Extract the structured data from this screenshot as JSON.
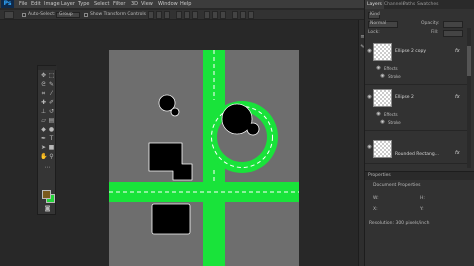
{
  "app": {
    "logo": "Ps"
  },
  "menu": [
    "File",
    "Edit",
    "Image",
    "Layer",
    "Type",
    "Select",
    "Filter",
    "3D",
    "View",
    "Window",
    "Help"
  ],
  "options_bar": {
    "auto_select_label": "Auto-Select:",
    "auto_select_value": "Group",
    "transform_controls_label": "Show Transform Controls"
  },
  "colors": {
    "accent_green": "#19e33a",
    "canvas_gray": "#6e6e6e",
    "shape_black": "#000000",
    "road_dash": "#ffffff",
    "foreground_swatch": "#7a5a1e",
    "background_swatch": "#24d43a"
  },
  "tools": [
    "move-tool",
    "marquee-tool",
    "lasso-tool",
    "quick-select-tool",
    "crop-tool",
    "eyedropper-tool",
    "healing-tool",
    "brush-tool",
    "stamp-tool",
    "history-brush-tool",
    "eraser-tool",
    "gradient-tool",
    "blur-tool",
    "dodge-tool",
    "pen-tool",
    "type-tool",
    "path-select-tool",
    "shape-tool",
    "hand-tool",
    "zoom-tool"
  ],
  "layers_panel": {
    "tabs": [
      "Layers",
      "Channels",
      "Paths",
      "Swatches"
    ],
    "filter_label": "Kind",
    "blend_mode": "Normal",
    "opacity_label": "Opacity:",
    "lock_label": "Lock:",
    "fill_label": "Fill:",
    "layers": [
      {
        "name": "Ellipse 2 copy",
        "effects_label": "Effects",
        "effect": "Stroke",
        "fx": "fx"
      },
      {
        "name": "Ellipse 2",
        "effects_label": "Effects",
        "effect": "Stroke",
        "fx": "fx"
      },
      {
        "name": "Rounded Rectang...",
        "fx": "fx"
      }
    ]
  },
  "properties_panel": {
    "title": "Properties",
    "subtitle": "Document Properties",
    "w_label": "W:",
    "h_label": "H:",
    "x_label": "X:",
    "y_label": "Y:",
    "resolution": "Resolution: 300 pixels/inch"
  }
}
